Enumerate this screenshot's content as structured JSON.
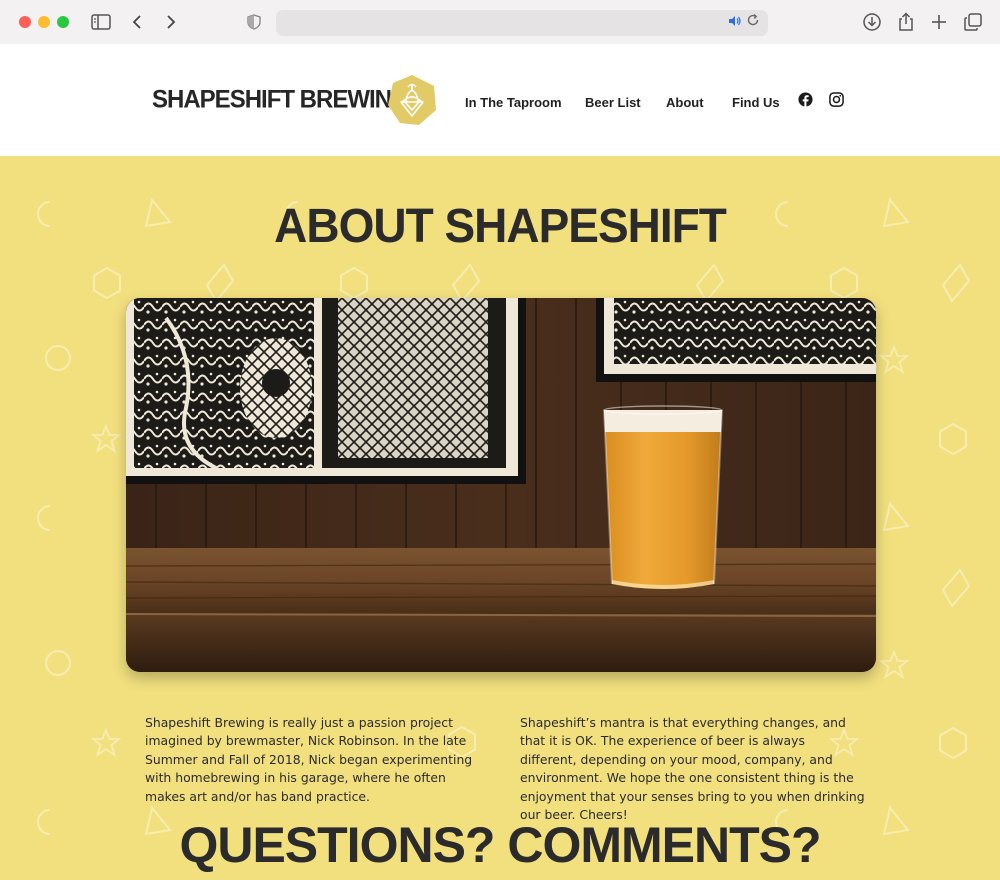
{
  "browser": {
    "back_glyph": "‹",
    "forward_glyph": "›",
    "url_text": "",
    "icons": [
      "sidebar-icon",
      "back-icon",
      "forward-icon",
      "shield-icon",
      "speaker-icon",
      "reload-icon",
      "download-icon",
      "share-icon",
      "new-tab-icon",
      "tabs-icon"
    ]
  },
  "header": {
    "brand": "SHAPESHIFT BREWING",
    "nav": {
      "taproom": "In The Taproom",
      "beer_list": "Beer List",
      "about": "About",
      "find_us": "Find Us"
    },
    "social": [
      "facebook-icon",
      "instagram-icon"
    ],
    "logo_color": "#e2cb67"
  },
  "main": {
    "background": "#f2e07f",
    "about_title": "ABOUT SHAPESHIFT",
    "paragraph_left": "Shapeshift Brewing is really just a passion project imagined by brewmaster, Nick Robinson. In the late Summer and Fall of 2018, Nick began experimenting with homebrewing in his garage, where he often makes art and/or has band practice.",
    "paragraph_right": "Shapeshift’s mantra is that everything changes, and that it is OK. The experience of beer is always different, depending on your mood, company, and environment. We hope the one consistent thing is the enjoyment that your senses bring to you when drinking our beer. Cheers!",
    "questions_title": "QUESTIONS? COMMENTS?"
  }
}
